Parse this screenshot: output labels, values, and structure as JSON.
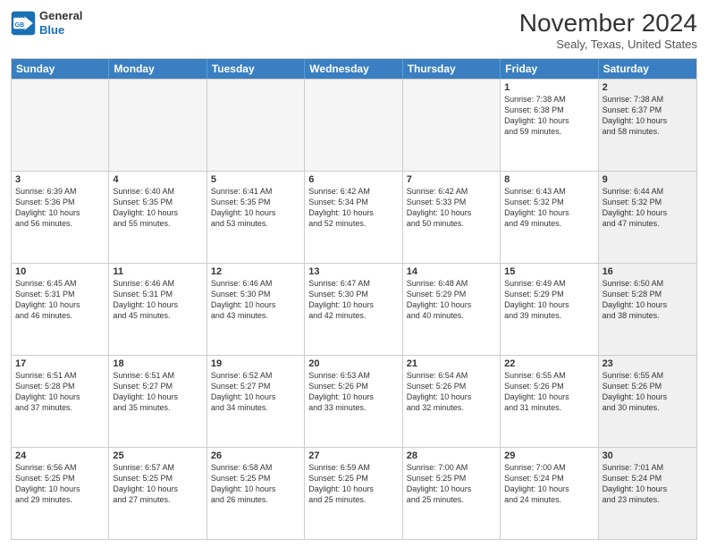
{
  "header": {
    "logo_line1": "General",
    "logo_line2": "Blue",
    "month": "November 2024",
    "location": "Sealy, Texas, United States"
  },
  "days_of_week": [
    "Sunday",
    "Monday",
    "Tuesday",
    "Wednesday",
    "Thursday",
    "Friday",
    "Saturday"
  ],
  "rows": [
    [
      {
        "day": "",
        "empty": true
      },
      {
        "day": "",
        "empty": true
      },
      {
        "day": "",
        "empty": true
      },
      {
        "day": "",
        "empty": true
      },
      {
        "day": "",
        "empty": true
      },
      {
        "day": "1",
        "lines": [
          "Sunrise: 7:38 AM",
          "Sunset: 6:38 PM",
          "Daylight: 10 hours",
          "and 59 minutes."
        ]
      },
      {
        "day": "2",
        "shaded": true,
        "lines": [
          "Sunrise: 7:38 AM",
          "Sunset: 6:37 PM",
          "Daylight: 10 hours",
          "and 58 minutes."
        ]
      }
    ],
    [
      {
        "day": "3",
        "lines": [
          "Sunrise: 6:39 AM",
          "Sunset: 5:36 PM",
          "Daylight: 10 hours",
          "and 56 minutes."
        ]
      },
      {
        "day": "4",
        "lines": [
          "Sunrise: 6:40 AM",
          "Sunset: 5:35 PM",
          "Daylight: 10 hours",
          "and 55 minutes."
        ]
      },
      {
        "day": "5",
        "lines": [
          "Sunrise: 6:41 AM",
          "Sunset: 5:35 PM",
          "Daylight: 10 hours",
          "and 53 minutes."
        ]
      },
      {
        "day": "6",
        "lines": [
          "Sunrise: 6:42 AM",
          "Sunset: 5:34 PM",
          "Daylight: 10 hours",
          "and 52 minutes."
        ]
      },
      {
        "day": "7",
        "lines": [
          "Sunrise: 6:42 AM",
          "Sunset: 5:33 PM",
          "Daylight: 10 hours",
          "and 50 minutes."
        ]
      },
      {
        "day": "8",
        "lines": [
          "Sunrise: 6:43 AM",
          "Sunset: 5:32 PM",
          "Daylight: 10 hours",
          "and 49 minutes."
        ]
      },
      {
        "day": "9",
        "shaded": true,
        "lines": [
          "Sunrise: 6:44 AM",
          "Sunset: 5:32 PM",
          "Daylight: 10 hours",
          "and 47 minutes."
        ]
      }
    ],
    [
      {
        "day": "10",
        "lines": [
          "Sunrise: 6:45 AM",
          "Sunset: 5:31 PM",
          "Daylight: 10 hours",
          "and 46 minutes."
        ]
      },
      {
        "day": "11",
        "lines": [
          "Sunrise: 6:46 AM",
          "Sunset: 5:31 PM",
          "Daylight: 10 hours",
          "and 45 minutes."
        ]
      },
      {
        "day": "12",
        "lines": [
          "Sunrise: 6:46 AM",
          "Sunset: 5:30 PM",
          "Daylight: 10 hours",
          "and 43 minutes."
        ]
      },
      {
        "day": "13",
        "lines": [
          "Sunrise: 6:47 AM",
          "Sunset: 5:30 PM",
          "Daylight: 10 hours",
          "and 42 minutes."
        ]
      },
      {
        "day": "14",
        "lines": [
          "Sunrise: 6:48 AM",
          "Sunset: 5:29 PM",
          "Daylight: 10 hours",
          "and 40 minutes."
        ]
      },
      {
        "day": "15",
        "lines": [
          "Sunrise: 6:49 AM",
          "Sunset: 5:29 PM",
          "Daylight: 10 hours",
          "and 39 minutes."
        ]
      },
      {
        "day": "16",
        "shaded": true,
        "lines": [
          "Sunrise: 6:50 AM",
          "Sunset: 5:28 PM",
          "Daylight: 10 hours",
          "and 38 minutes."
        ]
      }
    ],
    [
      {
        "day": "17",
        "lines": [
          "Sunrise: 6:51 AM",
          "Sunset: 5:28 PM",
          "Daylight: 10 hours",
          "and 37 minutes."
        ]
      },
      {
        "day": "18",
        "lines": [
          "Sunrise: 6:51 AM",
          "Sunset: 5:27 PM",
          "Daylight: 10 hours",
          "and 35 minutes."
        ]
      },
      {
        "day": "19",
        "lines": [
          "Sunrise: 6:52 AM",
          "Sunset: 5:27 PM",
          "Daylight: 10 hours",
          "and 34 minutes."
        ]
      },
      {
        "day": "20",
        "lines": [
          "Sunrise: 6:53 AM",
          "Sunset: 5:26 PM",
          "Daylight: 10 hours",
          "and 33 minutes."
        ]
      },
      {
        "day": "21",
        "lines": [
          "Sunrise: 6:54 AM",
          "Sunset: 5:26 PM",
          "Daylight: 10 hours",
          "and 32 minutes."
        ]
      },
      {
        "day": "22",
        "lines": [
          "Sunrise: 6:55 AM",
          "Sunset: 5:26 PM",
          "Daylight: 10 hours",
          "and 31 minutes."
        ]
      },
      {
        "day": "23",
        "shaded": true,
        "lines": [
          "Sunrise: 6:55 AM",
          "Sunset: 5:26 PM",
          "Daylight: 10 hours",
          "and 30 minutes."
        ]
      }
    ],
    [
      {
        "day": "24",
        "lines": [
          "Sunrise: 6:56 AM",
          "Sunset: 5:25 PM",
          "Daylight: 10 hours",
          "and 29 minutes."
        ]
      },
      {
        "day": "25",
        "lines": [
          "Sunrise: 6:57 AM",
          "Sunset: 5:25 PM",
          "Daylight: 10 hours",
          "and 27 minutes."
        ]
      },
      {
        "day": "26",
        "lines": [
          "Sunrise: 6:58 AM",
          "Sunset: 5:25 PM",
          "Daylight: 10 hours",
          "and 26 minutes."
        ]
      },
      {
        "day": "27",
        "lines": [
          "Sunrise: 6:59 AM",
          "Sunset: 5:25 PM",
          "Daylight: 10 hours",
          "and 25 minutes."
        ]
      },
      {
        "day": "28",
        "lines": [
          "Sunrise: 7:00 AM",
          "Sunset: 5:25 PM",
          "Daylight: 10 hours",
          "and 25 minutes."
        ]
      },
      {
        "day": "29",
        "lines": [
          "Sunrise: 7:00 AM",
          "Sunset: 5:24 PM",
          "Daylight: 10 hours",
          "and 24 minutes."
        ]
      },
      {
        "day": "30",
        "shaded": true,
        "lines": [
          "Sunrise: 7:01 AM",
          "Sunset: 5:24 PM",
          "Daylight: 10 hours",
          "and 23 minutes."
        ]
      }
    ]
  ]
}
